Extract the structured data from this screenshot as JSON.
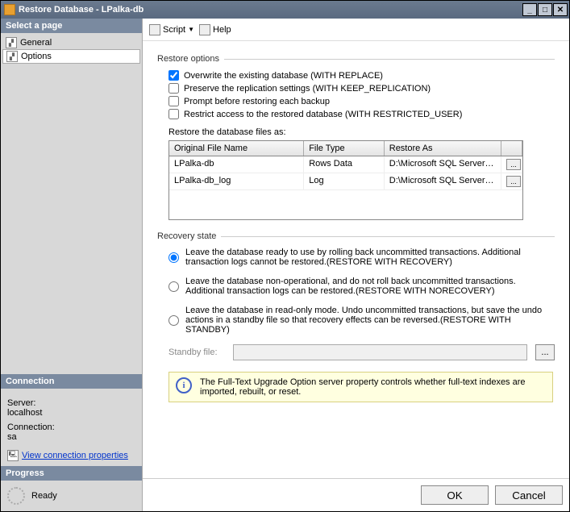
{
  "window_title": "Restore Database - LPalka-db",
  "sidebar": {
    "select_page": "Select a page",
    "pages": [
      {
        "label": "General"
      },
      {
        "label": "Options"
      }
    ],
    "connection_header": "Connection",
    "server_label": "Server:",
    "server_value": "localhost",
    "conn_label": "Connection:",
    "conn_value": "sa",
    "view_conn": "View connection properties",
    "progress_header": "Progress",
    "progress_status": "Ready"
  },
  "toolbar": {
    "script": "Script",
    "help": "Help"
  },
  "restore_options": {
    "header": "Restore options",
    "items": [
      {
        "checked": true,
        "label": "Overwrite the existing database (WITH REPLACE)"
      },
      {
        "checked": false,
        "label": "Preserve the replication settings (WITH KEEP_REPLICATION)"
      },
      {
        "checked": false,
        "label": "Prompt before restoring each backup"
      },
      {
        "checked": false,
        "label": "Restrict access to the restored database (WITH RESTRICTED_USER)"
      }
    ],
    "files_label": "Restore the database files as:",
    "table_headers": {
      "c1": "Original File Name",
      "c2": "File Type",
      "c3": "Restore As"
    },
    "rows": [
      {
        "name": "LPalka-db",
        "type": "Rows Data",
        "path": "D:\\Microsoft SQL Server\\MSSQ..."
      },
      {
        "name": "LPalka-db_log",
        "type": "Log",
        "path": "D:\\Microsoft SQL Server\\MSSQ..."
      }
    ]
  },
  "recovery": {
    "header": "Recovery state",
    "options": [
      "Leave the database ready to use by rolling back uncommitted transactions. Additional transaction logs cannot be restored.(RESTORE WITH RECOVERY)",
      "Leave the database non-operational, and do not roll back uncommitted transactions. Additional transaction logs can be restored.(RESTORE WITH NORECOVERY)",
      "Leave the database in read-only mode. Undo uncommitted transactions, but save the undo actions in a standby file so that recovery effects can be reversed.(RESTORE WITH STANDBY)"
    ],
    "standby_label": "Standby file:"
  },
  "info_text": "The Full-Text Upgrade Option server property controls whether full-text indexes are imported, rebuilt, or reset.",
  "buttons": {
    "ok": "OK",
    "cancel": "Cancel"
  }
}
